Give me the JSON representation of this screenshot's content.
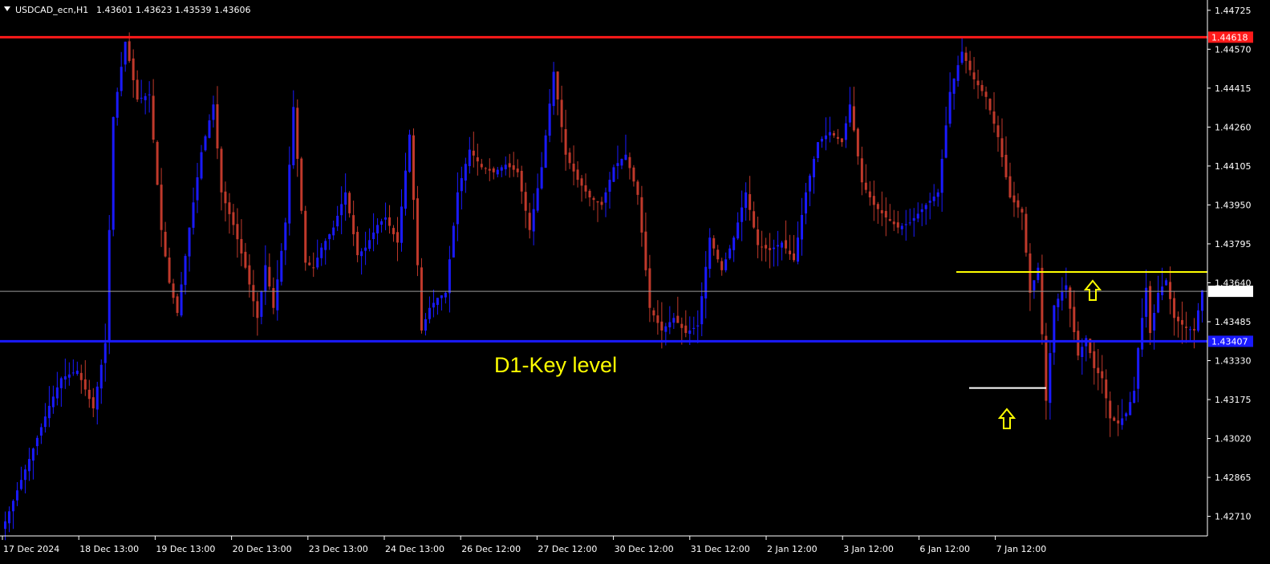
{
  "header": {
    "symbol": "USDCAD_ecn,H1",
    "ohlc": "1.43601 1.43623 1.43539 1.43606"
  },
  "colors": {
    "background": "#000000",
    "bull": "#1a1aff",
    "bear": "#c0392b",
    "axis": "#ffffff",
    "resistance": "#ff1a1a",
    "support": "#1a1aff",
    "breakout": "#ffff00",
    "bid": "#9a9a9a",
    "swing_low": "#ffffff",
    "arrow": "#ffff00"
  },
  "chart_data": {
    "type": "candlestick",
    "ylim": [
      1.42632,
      1.44766
    ],
    "y_ticks": [
      "1.44725",
      "1.44570",
      "1.44415",
      "1.44260",
      "1.44105",
      "1.43950",
      "1.43795",
      "1.43640",
      "1.43485",
      "1.43330",
      "1.43175",
      "1.43020",
      "1.42865",
      "1.42710"
    ],
    "x_labels": [
      "17 Dec 2024",
      "18 Dec 13:00",
      "19 Dec 13:00",
      "20 Dec 13:00",
      "23 Dec 13:00",
      "24 Dec 13:00",
      "26 Dec 12:00",
      "27 Dec 12:00",
      "30 Dec 12:00",
      "31 Dec 12:00",
      "2 Jan 12:00",
      "3 Jan 12:00",
      "6 Jan 12:00",
      "7 Jan 12:00"
    ],
    "levels": {
      "resistance": {
        "value": 1.44618,
        "label": "1.44618"
      },
      "current": {
        "value": 1.43606,
        "label": "1.43606"
      },
      "support": {
        "value": 1.43407,
        "label": "1.43407"
      },
      "breakout_level": 1.43683,
      "swing_low_level": 1.43221
    },
    "annotation": "D1-Key level",
    "swing_points": [
      [
        1.4273,
        1
      ],
      [
        1.4298,
        7
      ],
      [
        1.4315,
        11
      ],
      [
        1.4326,
        14
      ],
      [
        1.4329,
        18
      ],
      [
        1.4314,
        22
      ],
      [
        1.434,
        25
      ],
      [
        1.443,
        27
      ],
      [
        1.446,
        30
      ],
      [
        1.4437,
        33
      ],
      [
        1.4439,
        36
      ],
      [
        1.4385,
        39
      ],
      [
        1.4364,
        41
      ],
      [
        1.4352,
        43
      ],
      [
        1.4386,
        46
      ],
      [
        1.4416,
        49
      ],
      [
        1.4435,
        52
      ],
      [
        1.44,
        54
      ],
      [
        1.4387,
        57
      ],
      [
        1.437,
        60
      ],
      [
        1.435,
        63
      ],
      [
        1.4371,
        65
      ],
      [
        1.4354,
        67
      ],
      [
        1.4388,
        70
      ],
      [
        1.4434,
        72
      ],
      [
        1.4372,
        75
      ],
      [
        1.437,
        77
      ],
      [
        1.4378,
        79
      ],
      [
        1.4386,
        82
      ],
      [
        1.44,
        85
      ],
      [
        1.4375,
        88
      ],
      [
        1.4378,
        90
      ],
      [
        1.4387,
        93
      ],
      [
        1.439,
        95
      ],
      [
        1.438,
        98
      ],
      [
        1.4423,
        101
      ],
      [
        1.4345,
        104
      ],
      [
        1.4354,
        106
      ],
      [
        1.4358,
        108
      ],
      [
        1.436,
        110
      ],
      [
        1.44,
        113
      ],
      [
        1.4417,
        116
      ],
      [
        1.441,
        119
      ],
      [
        1.4408,
        122
      ],
      [
        1.4411,
        125
      ],
      [
        1.4408,
        128
      ],
      [
        1.4385,
        131
      ],
      [
        1.441,
        134
      ],
      [
        1.4448,
        137
      ],
      [
        1.4415,
        140
      ],
      [
        1.4405,
        143
      ],
      [
        1.4398,
        146
      ],
      [
        1.4395,
        149
      ],
      [
        1.441,
        152
      ],
      [
        1.4415,
        155
      ],
      [
        1.4399,
        158
      ],
      [
        1.4354,
        161
      ],
      [
        1.4345,
        164
      ],
      [
        1.435,
        167
      ],
      [
        1.4344,
        170
      ],
      [
        1.4347,
        173
      ],
      [
        1.4382,
        176
      ],
      [
        1.4369,
        179
      ],
      [
        1.4382,
        182
      ],
      [
        1.44,
        185
      ],
      [
        1.4379,
        188
      ],
      [
        1.4377,
        191
      ],
      [
        1.438,
        194
      ],
      [
        1.4373,
        197
      ],
      [
        1.44,
        200
      ],
      [
        1.442,
        203
      ],
      [
        1.4424,
        206
      ],
      [
        1.442,
        209
      ],
      [
        1.4435,
        211
      ],
      [
        1.4404,
        214
      ],
      [
        1.4395,
        217
      ],
      [
        1.439,
        220
      ],
      [
        1.4386,
        223
      ],
      [
        1.4388,
        226
      ],
      [
        1.4395,
        230
      ],
      [
        1.44,
        233
      ],
      [
        1.444,
        236
      ],
      [
        1.4456,
        239
      ],
      [
        1.4445,
        242
      ],
      [
        1.4438,
        245
      ],
      [
        1.4422,
        248
      ],
      [
        1.4398,
        251
      ],
      [
        1.4392,
        254
      ],
      [
        1.436,
        256
      ],
      [
        1.437,
        258
      ],
      [
        1.4317,
        260
      ],
      [
        1.4355,
        262
      ],
      [
        1.4363,
        265
      ],
      [
        1.4335,
        268
      ],
      [
        1.4342,
        270
      ],
      [
        1.433,
        272
      ],
      [
        1.4326,
        274
      ],
      [
        1.431,
        276
      ],
      [
        1.4308,
        278
      ],
      [
        1.4312,
        280
      ],
      [
        1.4321,
        282
      ],
      [
        1.4338,
        283
      ],
      [
        1.4362,
        285
      ],
      [
        1.4344,
        286
      ],
      [
        1.436,
        288
      ],
      [
        1.4365,
        290
      ],
      [
        1.435,
        292
      ],
      [
        1.4346,
        295
      ],
      [
        1.4345,
        297
      ],
      [
        1.4361,
        299
      ]
    ]
  }
}
